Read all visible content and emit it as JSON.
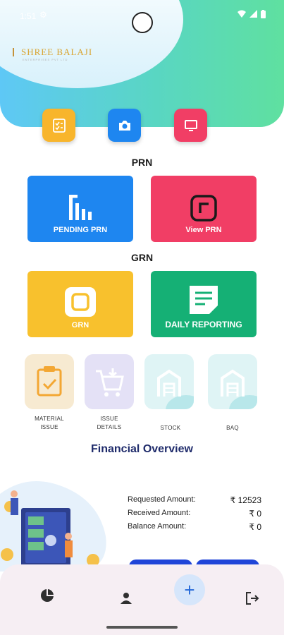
{
  "status_bar": {
    "time": "1:51",
    "settings_glyph": "⚙",
    "icons": [
      "wifi-icon",
      "signal-icon",
      "battery-icon"
    ]
  },
  "logo": {
    "name": "SHREE BALAJI",
    "tagline": "ENTERPRISES PVT LTD"
  },
  "quick_actions": [
    {
      "name": "checklist-icon",
      "color": "#f8b52c"
    },
    {
      "name": "camera-icon",
      "color": "#1e86f0"
    },
    {
      "name": "monitor-icon",
      "color": "#f13e65"
    }
  ],
  "prn": {
    "title": "PRN",
    "cards": [
      {
        "label": "PENDING PRN",
        "color": "#1e86f0"
      },
      {
        "label": "View PRN",
        "color": "#f13e65"
      }
    ]
  },
  "grn": {
    "title": "GRN",
    "cards": [
      {
        "label": "GRN",
        "color": "#f8c12d"
      },
      {
        "label": "DAILY REPORTING",
        "color": "#15b075"
      }
    ]
  },
  "tiles": [
    {
      "label_line1": "MATERIAL",
      "label_line2": "ISSUE"
    },
    {
      "label_line1": "ISSUE",
      "label_line2": "DETAILS"
    },
    {
      "label_line1": "STOCK",
      "label_line2": ""
    },
    {
      "label_line1": "BAQ",
      "label_line2": ""
    }
  ],
  "financial": {
    "title": "Financial Overview",
    "rows": [
      {
        "label": "Requested Amount:",
        "value": "₹ 12523"
      },
      {
        "label": "Received Amount:",
        "value": "₹ 0"
      },
      {
        "label": "Balance Amount:",
        "value": "₹ 0"
      }
    ]
  },
  "bottom_nav": {
    "items": [
      "pie-chart-icon",
      "user-icon",
      "add-icon",
      "logout-icon"
    ],
    "fab_glyph": "+"
  }
}
